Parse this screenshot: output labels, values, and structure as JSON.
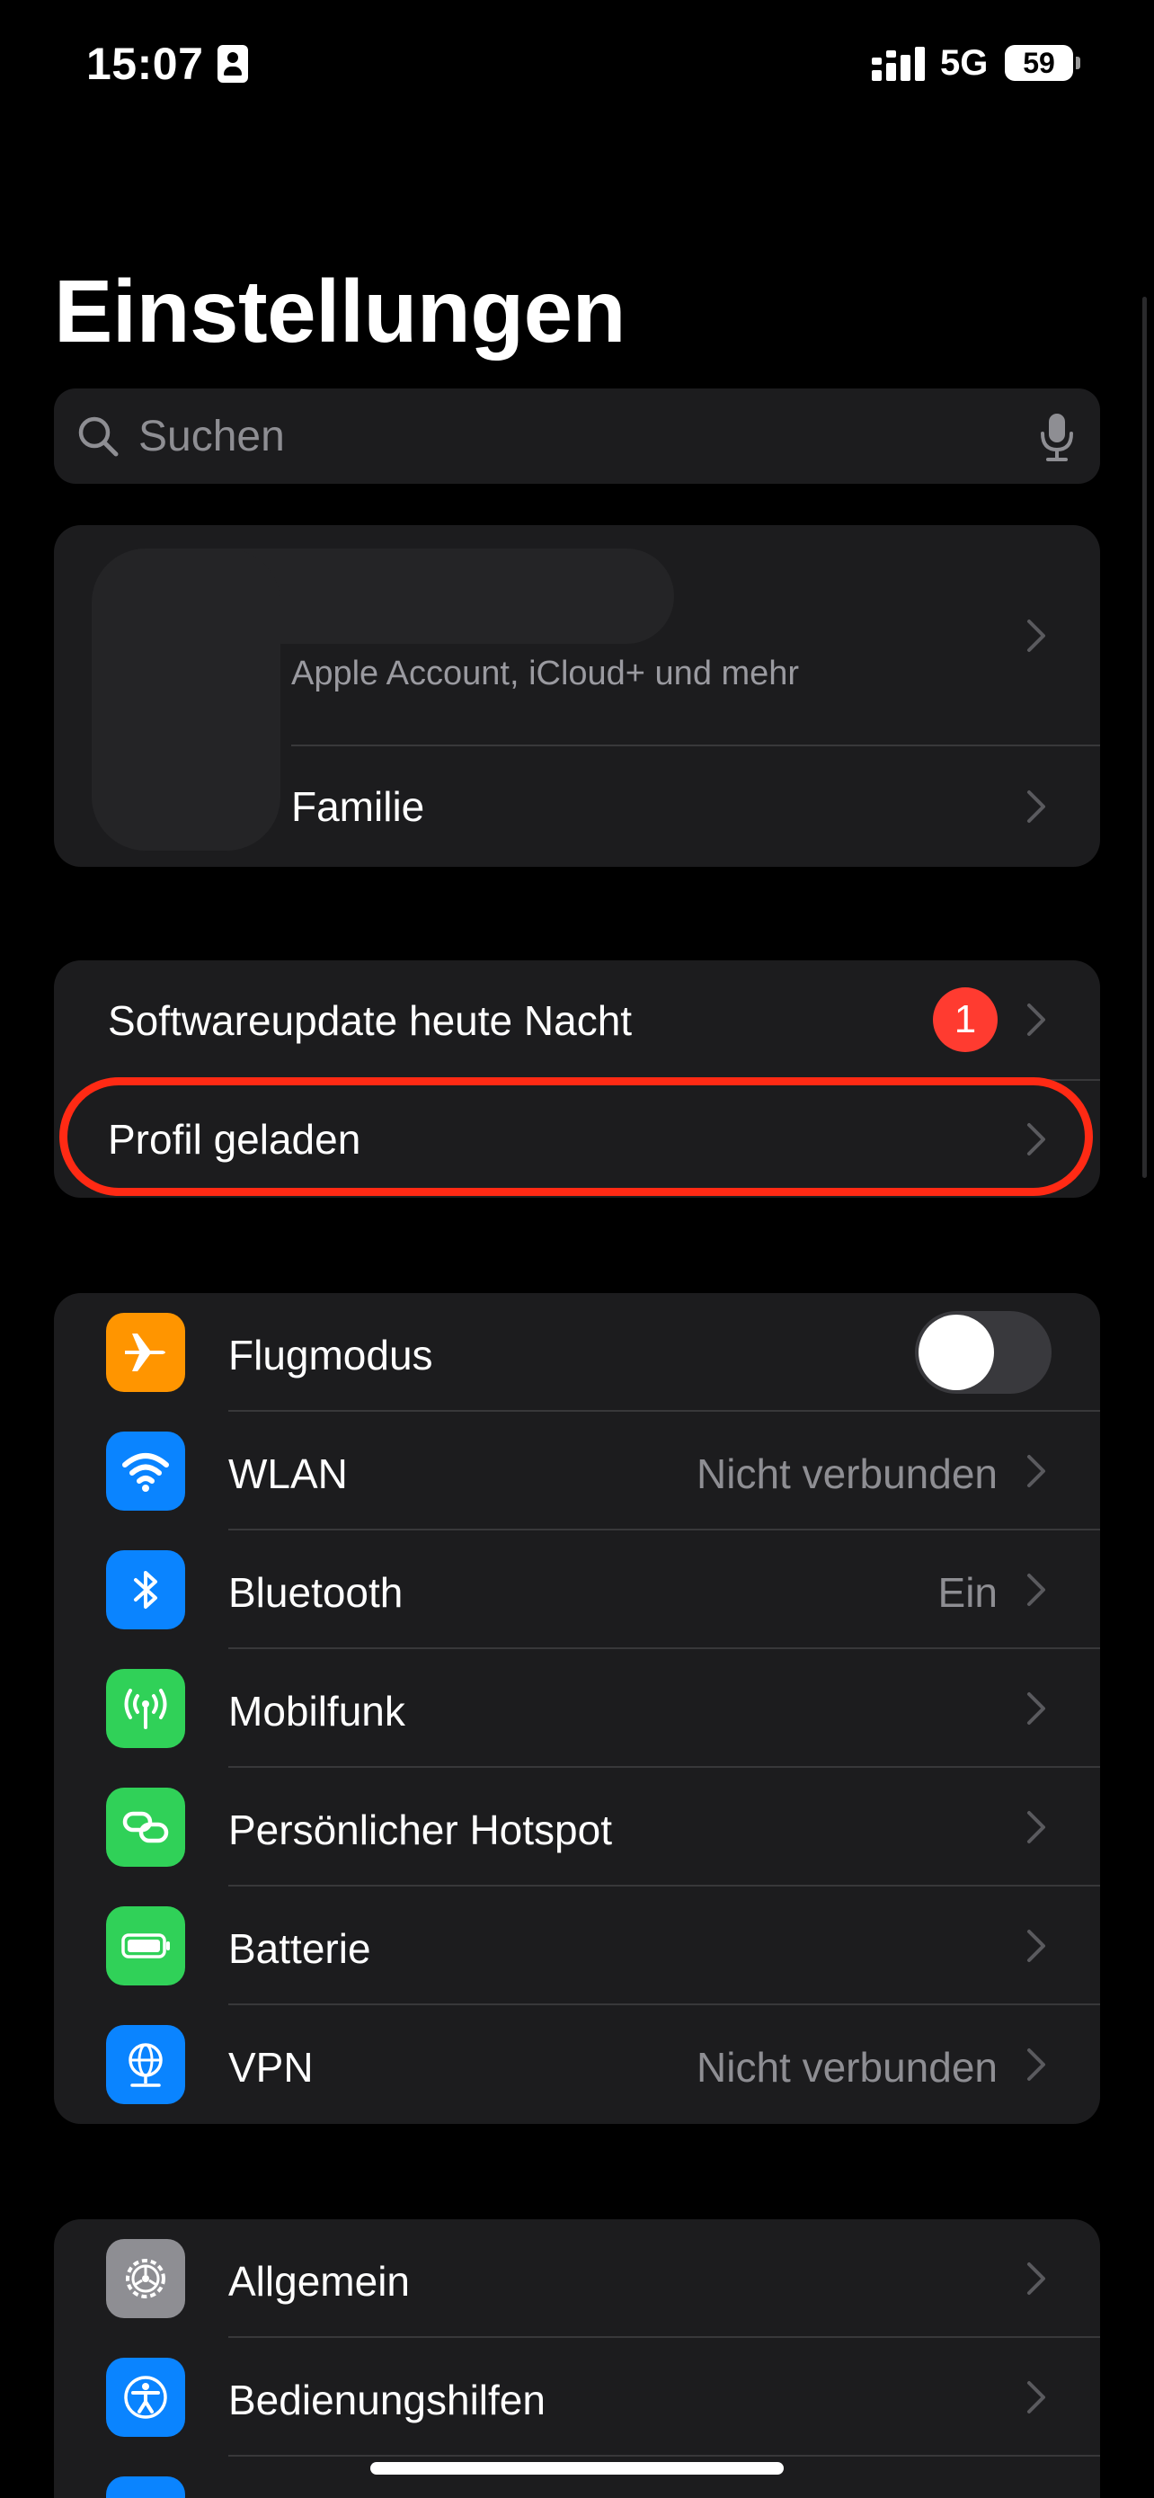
{
  "status_bar": {
    "time": "15:07",
    "network": "5G",
    "battery_level": "59"
  },
  "title": "Einstellungen",
  "search": {
    "placeholder": "Suchen"
  },
  "account": {
    "subtitle": "Apple Account, iCloud+ und mehr",
    "family_label": "Familie"
  },
  "notices": {
    "update_label": "Softwareupdate heute Nacht",
    "update_badge": "1",
    "profile_label": "Profil geladen"
  },
  "connectivity": [
    {
      "label": "Flugmodus",
      "icon": "airplane-icon",
      "color": "#ff9500",
      "toggle": false
    },
    {
      "label": "WLAN",
      "value": "Nicht verbunden",
      "icon": "wifi-icon",
      "color": "#0a84ff"
    },
    {
      "label": "Bluetooth",
      "value": "Ein",
      "icon": "bluetooth-icon",
      "color": "#0a84ff"
    },
    {
      "label": "Mobilfunk",
      "value": "",
      "icon": "antenna-icon",
      "color": "#30d158"
    },
    {
      "label": "Persönlicher Hotspot",
      "value": "",
      "icon": "hotspot-icon",
      "color": "#30d158"
    },
    {
      "label": "Batterie",
      "value": "",
      "icon": "battery-icon",
      "color": "#30d158"
    },
    {
      "label": "VPN",
      "value": "Nicht verbunden",
      "icon": "globe-icon",
      "color": "#0a84ff"
    }
  ],
  "general": [
    {
      "label": "Allgemein",
      "icon": "gear-icon",
      "color": "#8e8e93"
    },
    {
      "label": "Bedienungshilfen",
      "icon": "accessibility-icon",
      "color": "#0a84ff"
    },
    {
      "label": "",
      "icon": "partial-icon",
      "color": "#0a84ff"
    }
  ]
}
